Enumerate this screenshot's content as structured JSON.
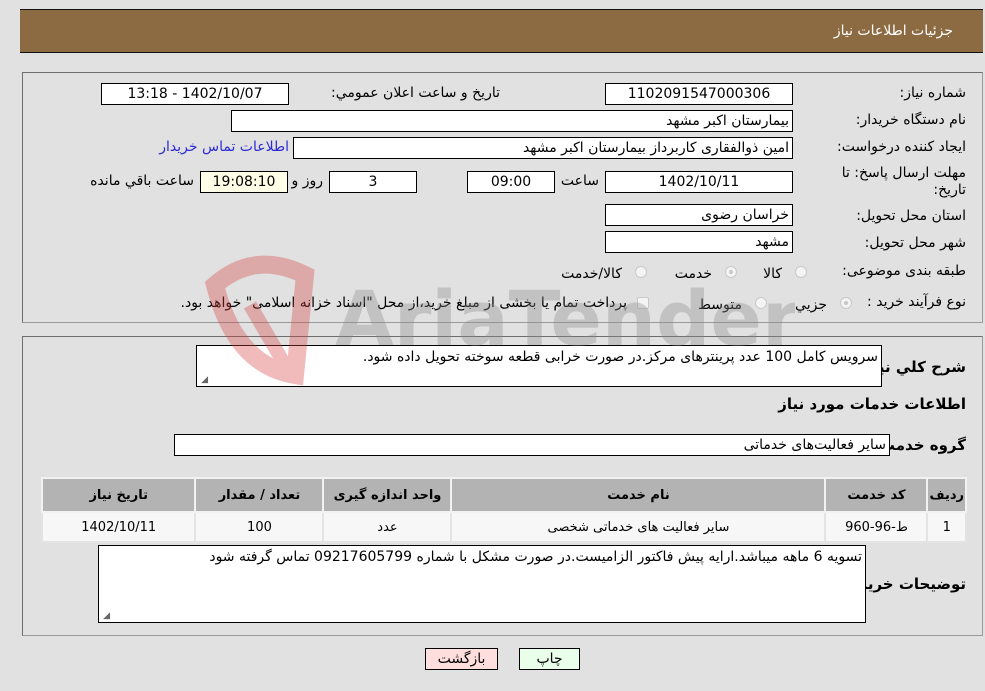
{
  "header": {
    "title": "جزئیات اطلاعات نیاز"
  },
  "details": {
    "need_number": {
      "label": "شماره نیاز:",
      "value": "1102091547000306"
    },
    "announce_datetime": {
      "label": "تاریخ و ساعت اعلان عمومي:",
      "value": "1402/10/07 - 13:18"
    },
    "buyer_org": {
      "label": "نام دستگاه خریدار:",
      "value": "بیمارستان اکبر مشهد"
    },
    "requester": {
      "label": "ایجاد کننده درخواست:",
      "value": "امین ذوالفقاری کاربرداز بیمارستان اکبر مشهد"
    },
    "buyer_contact_link": "اطلاعات تماس خریدار",
    "deadline": {
      "label": "مهلت ارسال پاسخ: تا تاریخ:",
      "date": "1402/10/11",
      "time_label": "ساعت",
      "time": "09:00",
      "days": "3",
      "days_label": "روز و",
      "remaining": "19:08:10",
      "remaining_label": "ساعت باقي مانده"
    },
    "province": {
      "label": "استان محل تحویل:",
      "value": "خراسان رضوی"
    },
    "city": {
      "label": "شهر محل تحویل:",
      "value": "مشهد"
    },
    "category": {
      "label": "طبقه بندی موضوعی:",
      "options": [
        "کالا",
        "خدمت",
        "کالا/خدمت"
      ],
      "selected": "خدمت"
    },
    "purchase_type": {
      "label": "نوع فرآیند خرید :",
      "options": [
        "جزیي",
        "متوسط"
      ],
      "selected": "جزیي",
      "treasury_note": "پرداخت تمام یا بخشی از مبلغ خرید،از محل \"اسناد خزانه اسلامی\" خواهد بود."
    }
  },
  "description": {
    "label": "شرح کلي نیاز:",
    "value": "سرویس کامل 100 عدد پرینترهای مرکز.در صورت خرابی قطعه سوخته تحویل داده شود."
  },
  "services_section": {
    "title": "اطلاعات خدمات مورد نیاز",
    "group_label": "گروه خدمت:",
    "group_value": "سایر فعالیت‌های خدماتی"
  },
  "table": {
    "headers": [
      "ردیف",
      "کد خدمت",
      "نام خدمت",
      "واحد اندازه گیری",
      "تعداد / مقدار",
      "تاریخ نیاز"
    ],
    "rows": [
      [
        "1",
        "ط-96-960",
        "سایر فعالیت های خدماتی شخصی",
        "عدد",
        "100",
        "1402/10/11"
      ]
    ]
  },
  "buyer_notes": {
    "label": "توضیحات خریدار:",
    "value": "تسویه 6 ماهه میباشد.ارایه پیش فاکتور الزامیست.در صورت مشکل با شماره 09217605799 تماس گرفته شود"
  },
  "buttons": {
    "print": "چاپ",
    "back": "بازگشت"
  },
  "colors": {
    "header_bg": "#8d6b42",
    "link": "#2b2bd6",
    "print_bg": "#eaffea",
    "back_bg": "#ffdede"
  },
  "watermark": "AriaTender.neT"
}
